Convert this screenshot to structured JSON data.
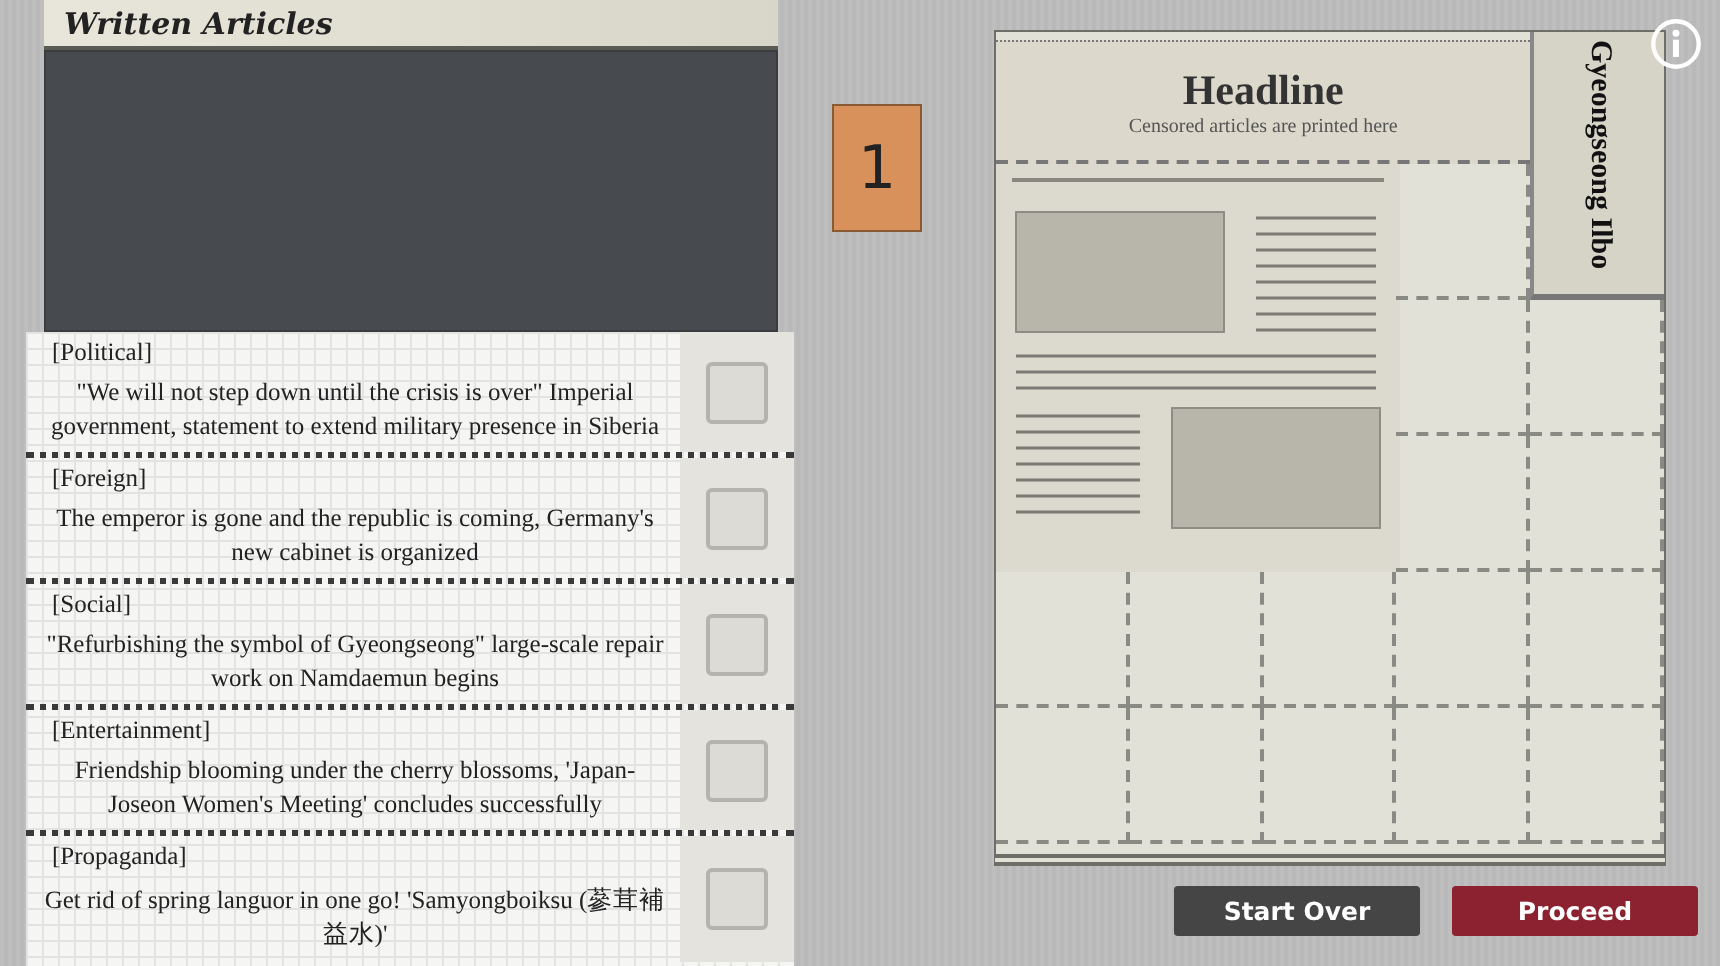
{
  "panel": {
    "title": "Written Articles"
  },
  "counter": "1",
  "articles": [
    {
      "category": "[Political]",
      "text": "\"We will not step down until the crisis is over\" Imperial government, statement to extend military presence in Siberia",
      "checked": false
    },
    {
      "category": "[Foreign]",
      "text": "The emperor is gone and the republic is coming, Germany's new cabinet is organized",
      "checked": false
    },
    {
      "category": "[Social]",
      "text": "\"Refurbishing the symbol of Gyeongseong\" large-scale repair work on Namdaemun begins",
      "checked": false
    },
    {
      "category": "[Entertainment]",
      "text": "Friendship blooming under the cherry blossoms, 'Japan-Joseon Women's Meeting' concludes successfully",
      "checked": false
    },
    {
      "category": "[Propaganda]",
      "text": "Get rid of spring languor in one go! 'Samyongboiksu (蔘茸補益水)'",
      "checked": false
    }
  ],
  "newspaper": {
    "headline": "Headline",
    "subtitle": "Censored articles are printed here",
    "masthead": "Gyeongseong Ilbo"
  },
  "buttons": [
    {
      "label": "Start Over",
      "kind": "secondary"
    },
    {
      "label": "Proceed",
      "kind": "primary"
    }
  ]
}
